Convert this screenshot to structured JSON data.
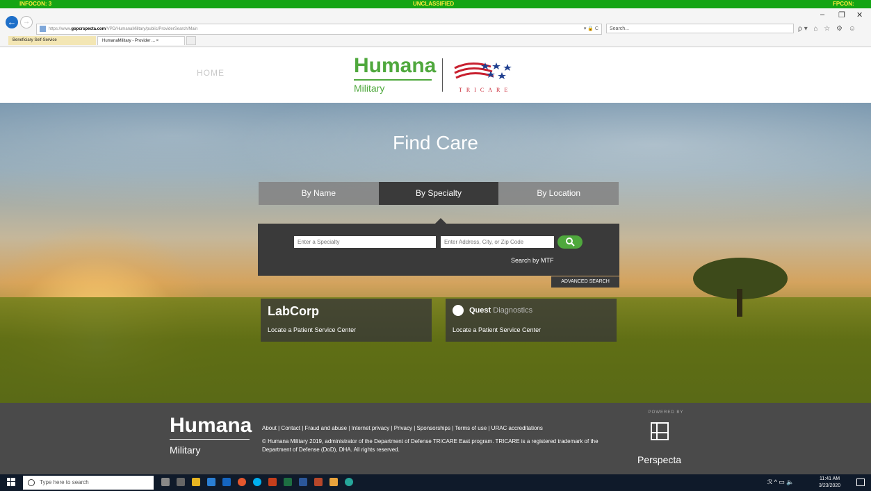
{
  "banner": {
    "left": "INFOCON: 3",
    "center": "UNCLASSIFIED",
    "right": "FPCON: Bravo"
  },
  "browser": {
    "url_prefix": "https://www.",
    "url_domain": "gopcrspecta.com",
    "url_path": "/VPD/HumanaMilitary/public/ProviderSearch/Main",
    "address_controls": "▾ 🔒 C",
    "search_placeholder": "Search...",
    "tabs": [
      {
        "label": "Beneficiary Self-Service"
      },
      {
        "label": "HumanaMilitary - Provider ... ×"
      }
    ],
    "window_controls": {
      "minimize": "–",
      "restore": "❐",
      "close": "✕"
    },
    "tool_icons": "ρ▾ ⌂ ☆ ⚙ ☺"
  },
  "header": {
    "home_label": "HOME",
    "logo_humana": "Humana",
    "logo_military": "Military",
    "tricare_text": "TRICARE"
  },
  "hero": {
    "title": "Find Care",
    "tabs": [
      {
        "label": "By Name"
      },
      {
        "label": "By Specialty"
      },
      {
        "label": "By Location"
      }
    ],
    "active_tab": "By Specialty",
    "specialty_placeholder": "Enter a Specialty",
    "address_placeholder": "Enter Address, City, or Zip Code",
    "search_by_mtf": "Search by MTF",
    "advanced_search": "ADVANCED SEARCH",
    "labs": [
      {
        "name": "LabCorp",
        "link": "Locate a Patient Service Center"
      },
      {
        "name_bold": "Quest",
        "name_light": "Diagnostics",
        "link": "Locate a Patient Service Center"
      }
    ]
  },
  "footer": {
    "logo_humana": "Humana",
    "logo_military": "Military",
    "links": "About | Contact | Fraud and abuse | Internet privacy | Privacy | Sponsorships | Terms of use | URAC accreditations",
    "copyright": "© Humana Military 2019, administrator of the Department of Defense TRICARE East program. TRICARE is a registered trademark of the Department of Defense (DoD), DHA. All rights reserved.",
    "powered_by": "POWERED BY",
    "perspecta": "Perspecta"
  },
  "taskbar": {
    "search_placeholder": "Type here to search",
    "time": "11:41 AM",
    "date": "3/23/2020",
    "tray": "ℛ ^ ▭ 🔈"
  },
  "colors": {
    "brand_green": "#4fa83d",
    "banner_green": "#14a514",
    "panel_dark": "#3a3a3a",
    "footer_gray": "#4a4a4a"
  }
}
